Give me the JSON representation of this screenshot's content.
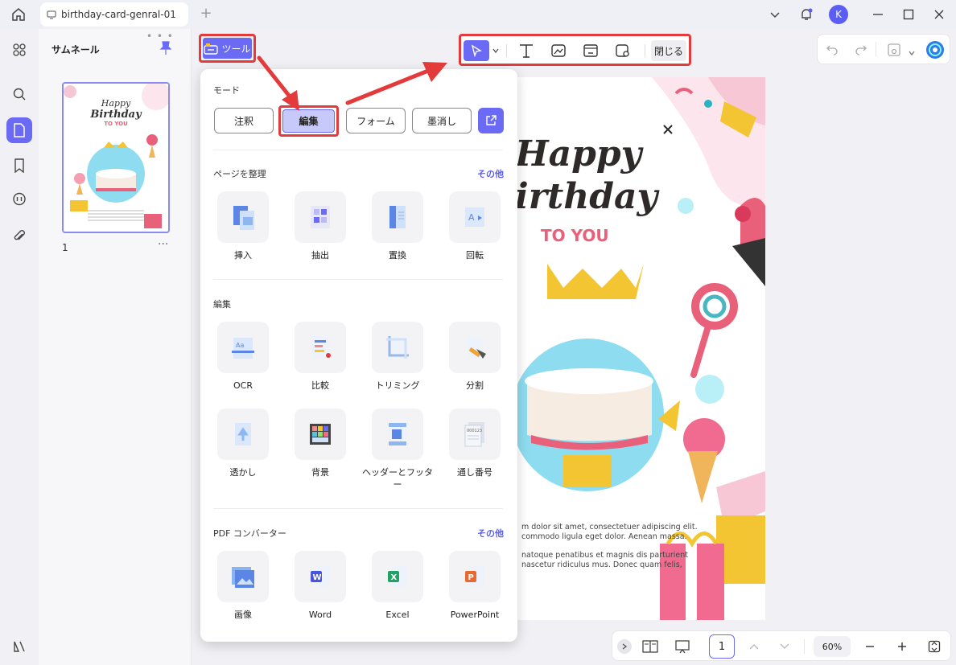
{
  "tab": {
    "title": "birthday-card-genral-01"
  },
  "user": {
    "initial": "K"
  },
  "thumbnails": {
    "title": "サムネール",
    "page_number": "1",
    "more": "···"
  },
  "thumb_card": {
    "line1": "Happy",
    "line2": "Birthday",
    "line3": "TO YOU"
  },
  "tools_button": {
    "label": "ツール"
  },
  "toolbar": {
    "close_label": "閉じる"
  },
  "panel": {
    "mode_title": "モード",
    "modes": [
      "注釈",
      "編集",
      "フォーム",
      "墨消し"
    ],
    "organize": {
      "title": "ページを整理",
      "more": "その他",
      "items": [
        "挿入",
        "抽出",
        "置換",
        "回転"
      ]
    },
    "edit": {
      "title": "編集",
      "items": [
        "OCR",
        "比較",
        "トリミング",
        "分割",
        "透かし",
        "背景",
        "ヘッダーとフッター",
        "通し番号"
      ]
    },
    "converter": {
      "title": "PDF コンバーター",
      "more": "その他",
      "items": [
        "画像",
        "Word",
        "Excel",
        "PowerPoint"
      ]
    }
  },
  "document": {
    "title_line1": "Happy",
    "title_line2": "irthday",
    "subtitle": "TO YOU",
    "body": [
      "m dolor sit amet, consectetuer adipiscing elit.",
      "commodo ligula eget dolor. Aenean massa.",
      "natoque penatibus et magnis dis parturient",
      "nascetur ridiculus mus. Donec quam felis,"
    ]
  },
  "bottombar": {
    "page": "1",
    "zoom": "60%"
  },
  "colors": {
    "accent": "#6a6af4",
    "highlight": "#e33b3b",
    "doc_pink": "#e9607a",
    "doc_blue": "#8edcf0"
  }
}
